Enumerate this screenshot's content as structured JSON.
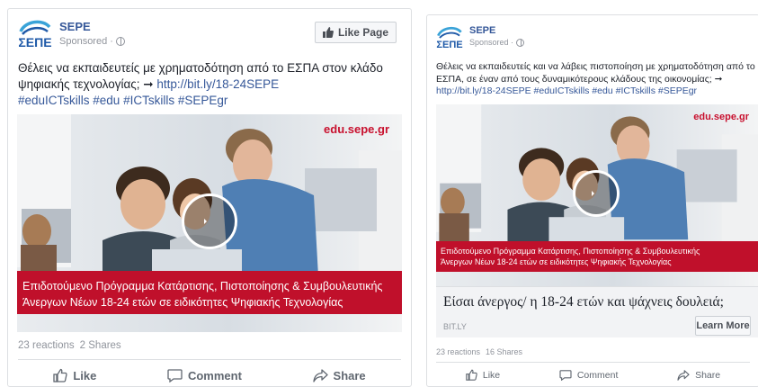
{
  "left_post": {
    "page_name": "SEPE",
    "sponsored": "Sponsored ·",
    "like_page_label": "Like Page",
    "text_line1": "Θέλεις να εκπαιδευτείς με χρηματοδότηση από το ΕΣΠΑ στον κλάδο",
    "text_line2": "ψηφιακής τεχνολογίας; ➞",
    "link": "http://bit.ly/18-24SEPE",
    "hashtags": "#eduICTskills #edu #ICTskills #SEPEgr",
    "brand_url": "edu.sepe.gr",
    "band_line1": "Επιδοτούμενο Πρόγραμμα Κατάρτισης, Πιστοποίησης & Συμβουλευτικής",
    "band_line2": "Άνεργων Νέων 18-24 ετών σε ειδικότητες Ψηφιακής Τεχνολογίας",
    "reactions": "23 reactions",
    "shares": "2 Shares",
    "actions": {
      "like": "Like",
      "comment": "Comment",
      "share": "Share"
    }
  },
  "right_post": {
    "page_name": "SEPE",
    "sponsored": "Sponsored ·",
    "text_line1": "Θέλεις να εκπαιδευτείς και να λάβεις πιστοποίηση με χρηματοδότηση από το",
    "text_line2": "ΕΣΠΑ, σε έναν από τους δυναμικότερους κλάδους της οικονομίας; ➞",
    "link_and_tags": "http://bit.ly/18-24SEPE #eduICTskills #edu #ICTskills #SEPEgr",
    "brand_url": "edu.sepe.gr",
    "band_line1": "Επιδοτούμενο Πρόγραμμα Κατάρτισης, Πιστοποίησης & Συμβουλευτικής",
    "band_line2": "Άνεργων Νέων 18-24 ετών σε ειδικότητες Ψηφιακής Τεχνολογίας",
    "headline": "Είσαι άνεργος/ η 18-24 ετών και ψάχνεις δουλειά;",
    "domain": "BIT.LY",
    "cta": "Learn More",
    "reactions": "23 reactions",
    "shares": "16 Shares",
    "actions": {
      "like": "Like",
      "comment": "Comment",
      "share": "Share"
    }
  },
  "logo": {
    "text": "ΣΕΠΕ",
    "color": "#1f5aa8"
  },
  "colors": {
    "brand_red": "#c0102b",
    "link_blue": "#365899"
  }
}
